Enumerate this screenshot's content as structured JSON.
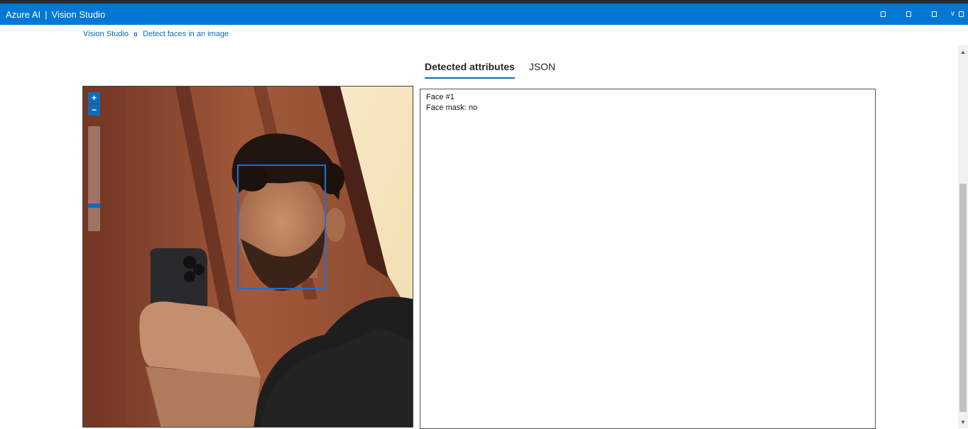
{
  "header": {
    "brand": "Azure AI",
    "separator": "|",
    "product": "Vision Studio",
    "icons": [
      "window-icon",
      "window-icon",
      "window-icon",
      "chevron-down-icon",
      "window-icon"
    ]
  },
  "breadcrumb": {
    "items": [
      "Vision Studio",
      "Detect faces in an image"
    ]
  },
  "tabs": [
    {
      "label": "Detected attributes",
      "active": true
    },
    {
      "label": "JSON",
      "active": false
    }
  ],
  "viewer": {
    "zoom_in_label": "+",
    "zoom_out_label": "−",
    "zoom_level": 0.77
  },
  "attributes": {
    "face_title": "Face #1",
    "face_mask": "Face mask: no"
  },
  "colors": {
    "accent": "#0078d4",
    "link": "#0f6cbd",
    "face_box": "#1f6fd1"
  }
}
